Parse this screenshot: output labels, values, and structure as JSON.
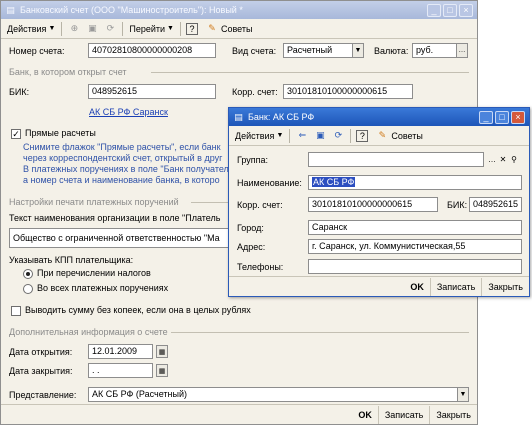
{
  "main": {
    "title": "Банковский счет (ООО \"Машиностроитель\"): Новый *",
    "toolbar": {
      "actions": "Действия",
      "goto": "Перейти",
      "advice": "Советы"
    },
    "account_number_label": "Номер счета:",
    "account_number": "40702810800000000208",
    "account_type_label": "Вид счета:",
    "account_type": "Расчетный",
    "currency_label": "Валюта:",
    "currency": "руб.",
    "bank_section": "Банк, в котором открыт счет",
    "bik_label": "БИК:",
    "bik": "048952615",
    "corr_label": "Корр. счет:",
    "corr": "30101810100000000615",
    "bank_link": "АК СБ РФ Саранск",
    "direct_label": "Прямые расчеты",
    "hint_lines": [
      "Снимите флажок \"Прямые расчеты\", если банк",
      "через корреспондентский счет, открытый в друг",
      "В платежных поручениях в поле \"Банк получател",
      "а номер счета и наименование банка, в которо"
    ],
    "print_section": "Настройки печати платежных поручений",
    "org_text_label": "Текст наименования организации в поле \"Платель",
    "org_text": "Общество с ограниченной ответственностью \"Ма",
    "kpp_label": "Указывать КПП плательщика:",
    "radio_taxes": "При перечислении налогов",
    "radio_all": "Во всех платежных поручениях",
    "no_kopecks_label": "Выводить сумму без копеек, если она в целых рублях",
    "extra_section": "Дополнительная информация о счете",
    "open_date_label": "Дата открытия:",
    "open_date": "12.01.2009",
    "close_date_label": "Дата закрытия:",
    "close_date": " .  .",
    "repr_label": "Представление:",
    "repr": "АК СБ РФ (Расчетный)",
    "footer": {
      "ok": "OK",
      "save": "Записать",
      "close": "Закрыть"
    }
  },
  "bank": {
    "title": "Банк: АК СБ РФ",
    "toolbar": {
      "actions": "Действия",
      "advice": "Советы"
    },
    "group_label": "Группа:",
    "group": "",
    "name_label": "Наименование:",
    "name": "АК СБ РФ",
    "corr_label": "Корр. счет:",
    "corr": "30101810100000000615",
    "bik_label": "БИК:",
    "bik": "048952615",
    "city_label": "Город:",
    "city": "Саранск",
    "address_label": "Адрес:",
    "address": "г. Саранск, ул. Коммунистическая,55",
    "phones_label": "Телефоны:",
    "phones": "",
    "footer": {
      "ok": "OK",
      "save": "Записать",
      "close": "Закрыть"
    }
  },
  "colors": {
    "active_title": "#1d55b8",
    "inactive_title": "#a8b8da",
    "link": "#1a3fb5",
    "hint": "#2f52a8"
  }
}
